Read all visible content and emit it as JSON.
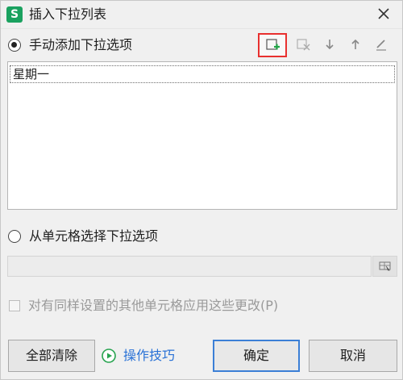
{
  "window": {
    "app_icon_letter": "S",
    "title": "插入下拉列表"
  },
  "manual": {
    "label": "手动添加下拉选项",
    "selected": true,
    "toolbar": {
      "add_icon": "add-item-icon",
      "delete_icon": "delete-item-icon",
      "move_down_icon": "arrow-down-icon",
      "move_up_icon": "arrow-up-icon",
      "edit_icon": "pencil-icon"
    },
    "items": [
      "星期一"
    ]
  },
  "from_cells": {
    "label": "从单元格选择下拉选项",
    "selected": false,
    "range_value": ""
  },
  "apply_all": {
    "label": "对有同样设置的其他单元格应用这些更改(P)",
    "checked": false
  },
  "buttons": {
    "clear_all": "全部清除",
    "tips": "操作技巧",
    "ok": "确定",
    "cancel": "取消"
  },
  "colors": {
    "highlight_border": "#e8302f",
    "primary_border": "#3b7fd6",
    "link": "#2a72d6",
    "app_icon": "#1aa15f"
  }
}
